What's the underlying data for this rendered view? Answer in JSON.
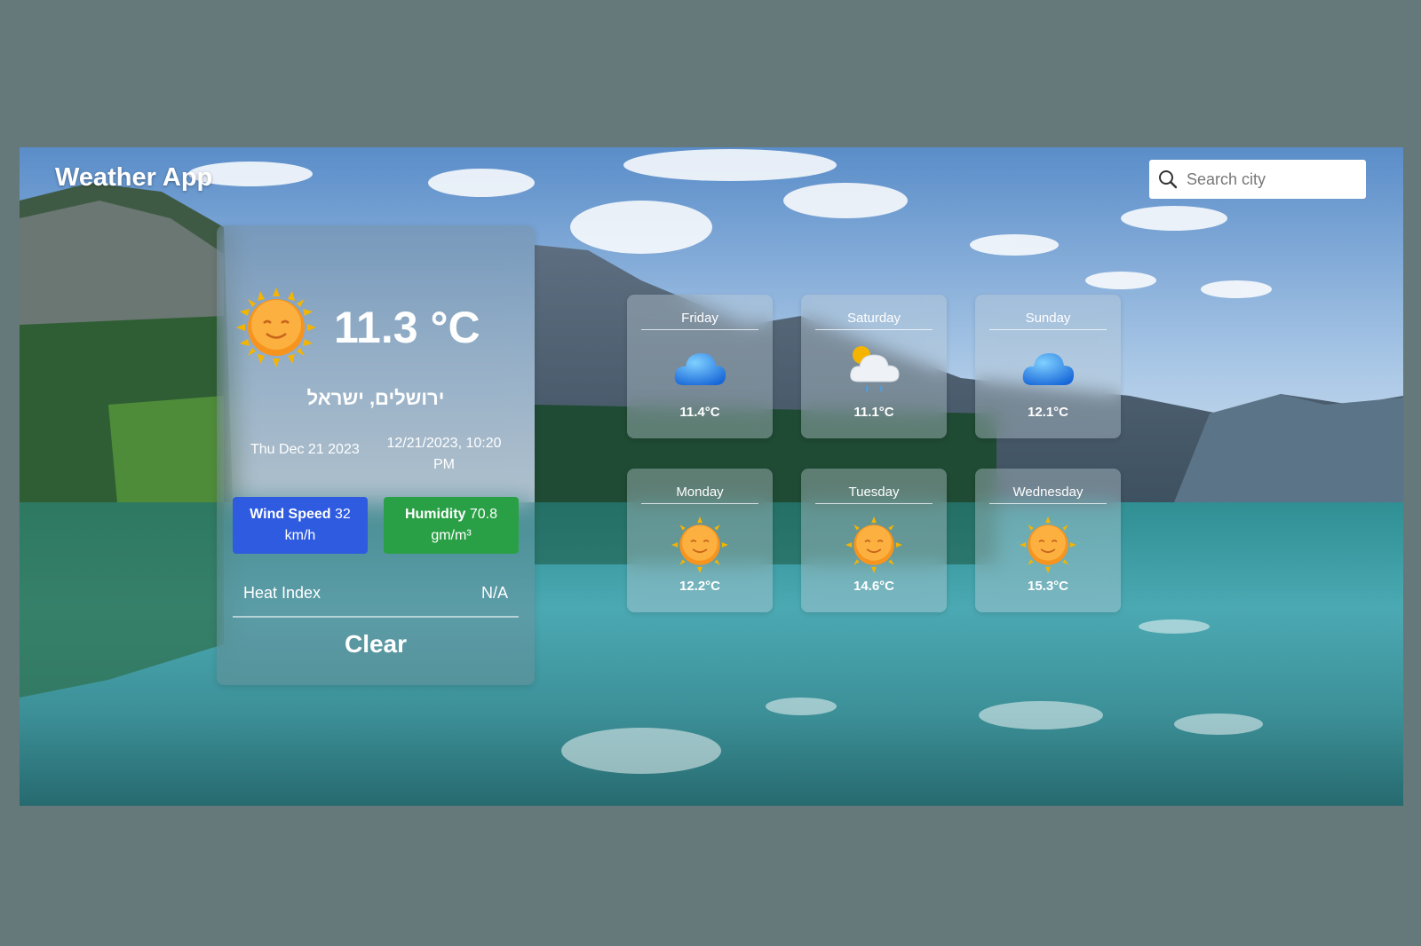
{
  "app": {
    "title": "Weather App"
  },
  "search": {
    "placeholder": "Search city",
    "icon": "search-icon"
  },
  "current": {
    "icon": "sun-icon",
    "temperature": "11.3 °C",
    "location": "ירושלים, ישראל",
    "date": "Thu Dec 21 2023",
    "datetime": "12/21/2023, 10:20 PM",
    "wind": {
      "label": "Wind Speed",
      "value": "32 km/h",
      "color": "#2e5be0"
    },
    "humidity": {
      "label": "Humidity",
      "value": "70.8 gm/m³",
      "color": "#2aa046"
    },
    "heat_index": {
      "label": "Heat Index",
      "value": "N/A"
    },
    "clear_label": "Clear"
  },
  "forecast": [
    {
      "day": "Friday",
      "temp": "11.4°C",
      "icon": "cloud-icon"
    },
    {
      "day": "Saturday",
      "temp": "11.1°C",
      "icon": "partly-cloudy-rain-icon"
    },
    {
      "day": "Sunday",
      "temp": "12.1°C",
      "icon": "cloud-icon"
    },
    {
      "day": "Monday",
      "temp": "12.2°C",
      "icon": "sun-icon"
    },
    {
      "day": "Tuesday",
      "temp": "14.6°C",
      "icon": "sun-icon"
    },
    {
      "day": "Wednesday",
      "temp": "15.3°C",
      "icon": "sun-icon"
    }
  ]
}
